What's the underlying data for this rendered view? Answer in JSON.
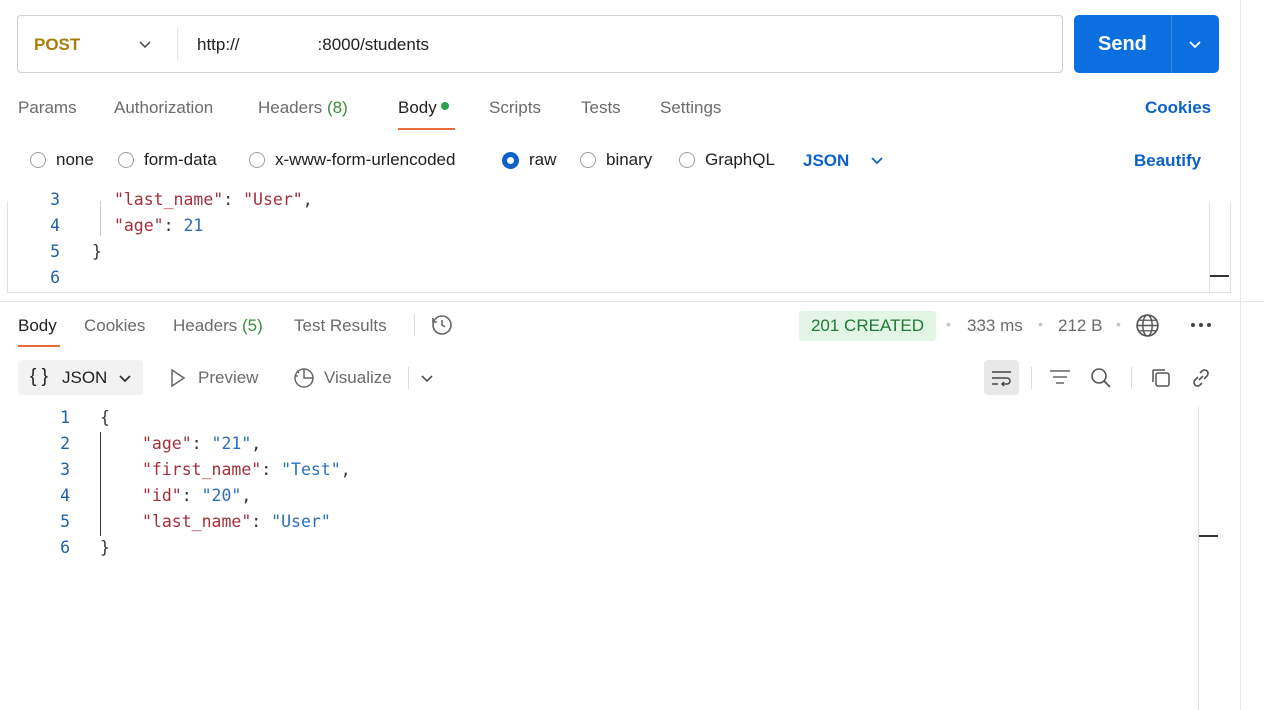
{
  "request": {
    "method": "POST",
    "url_prefix": "http://",
    "url_suffix": ":8000/students",
    "send_label": "Send"
  },
  "request_tabs": [
    {
      "label": "Params"
    },
    {
      "label": "Authorization"
    },
    {
      "label": "Headers",
      "count": "(8)"
    },
    {
      "label": "Body"
    },
    {
      "label": "Scripts"
    },
    {
      "label": "Tests"
    },
    {
      "label": "Settings"
    }
  ],
  "cookies_label": "Cookies",
  "body_types": [
    "none",
    "form-data",
    "x-www-form-urlencoded",
    "raw",
    "binary",
    "GraphQL"
  ],
  "body_format": "JSON",
  "beautify_label": "Beautify",
  "request_body": {
    "lines": [
      {
        "n": "3",
        "key": "\"last_name\"",
        "sep": ": ",
        "val": "\"User\"",
        "tail": ","
      },
      {
        "n": "4",
        "key": "\"age\"",
        "sep": ": ",
        "val": "21",
        "tail": ""
      },
      {
        "n": "5",
        "text": "}"
      },
      {
        "n": "6",
        "text": ""
      }
    ]
  },
  "response_tabs": [
    {
      "label": "Body"
    },
    {
      "label": "Cookies"
    },
    {
      "label": "Headers",
      "count": "(5)"
    },
    {
      "label": "Test Results"
    }
  ],
  "response_meta": {
    "status": "201 CREATED",
    "time": "333 ms",
    "size": "212 B"
  },
  "response_toolbar": {
    "format": "JSON",
    "format_brace": "{ }",
    "preview": "Preview",
    "visualize": "Visualize"
  },
  "response_body": {
    "lines": [
      {
        "n": "1",
        "text": "{"
      },
      {
        "n": "2",
        "key": "\"age\"",
        "sep": ": ",
        "val": "\"21\"",
        "tail": ","
      },
      {
        "n": "3",
        "key": "\"first_name\"",
        "sep": ": ",
        "val": "\"Test\"",
        "tail": ","
      },
      {
        "n": "4",
        "key": "\"id\"",
        "sep": ": ",
        "val": "\"20\"",
        "tail": ","
      },
      {
        "n": "5",
        "key": "\"last_name\"",
        "sep": ": ",
        "val": "\"User\"",
        "tail": ""
      },
      {
        "n": "6",
        "text": "}"
      }
    ]
  },
  "icons": [
    "chevron-down-icon",
    "history-icon",
    "globe-icon",
    "more-icon",
    "play-icon",
    "visualize-icon",
    "wrap-icon",
    "filter-icon",
    "search-icon",
    "copy-icon",
    "link-icon"
  ],
  "colors": {
    "accent": "#0c6fe0",
    "tab_underline": "#e86b3a",
    "status_bg": "#e3f6e6",
    "status_text": "#1d7a33",
    "method": "#a97d09"
  }
}
